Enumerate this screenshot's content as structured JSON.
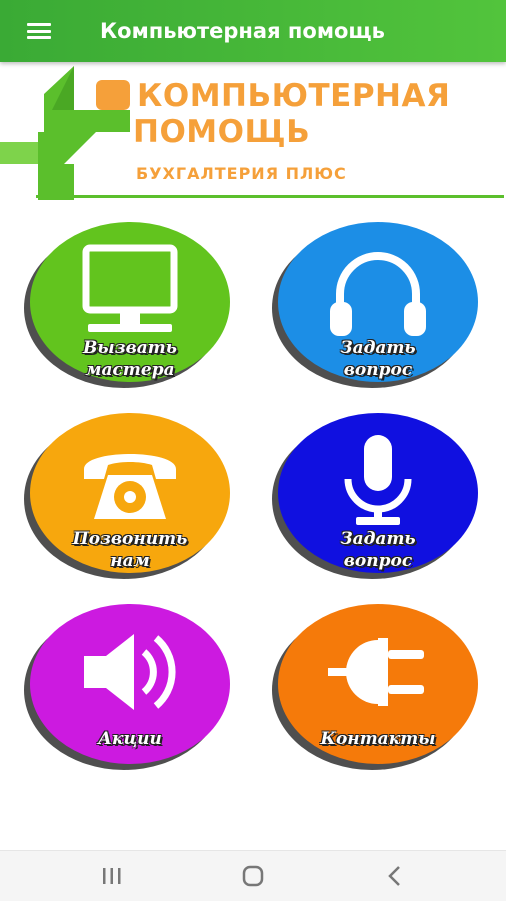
{
  "app_bar": {
    "title": "Компьютерная помощь",
    "bg_color": "#3aaa35",
    "menu_icon": "hamburger-menu-icon"
  },
  "logo": {
    "line1": "КОМПЬЮТЕРНАЯ",
    "line2": "ПОМОЩЬ",
    "subtitle": "БУХГАЛТЕРИЯ ПЛЮС",
    "text_color": "#f5a03a",
    "mark_color": "#5bbf2c"
  },
  "buttons": [
    {
      "line1": "Вызвать",
      "line2": "мастера",
      "color": "#62c41e",
      "icon": "monitor-icon"
    },
    {
      "line1": "Задать",
      "line2": "вопрос",
      "color": "#1c8ee6",
      "icon": "headphones-icon"
    },
    {
      "line1": "Позвонить",
      "line2": "нам",
      "color": "#f7a70d",
      "icon": "telephone-icon"
    },
    {
      "line1": "Задать",
      "line2": "вопрос",
      "color": "#1010e0",
      "icon": "microphone-icon"
    },
    {
      "line1": "Акции",
      "color": "#cc1ae0",
      "icon": "speaker-icon"
    },
    {
      "line1": "Контакты",
      "color": "#f57a0a",
      "icon": "plug-icon"
    }
  ],
  "nav_bar": {
    "recents": "recents-icon",
    "home": "home-icon",
    "back": "back-icon"
  }
}
